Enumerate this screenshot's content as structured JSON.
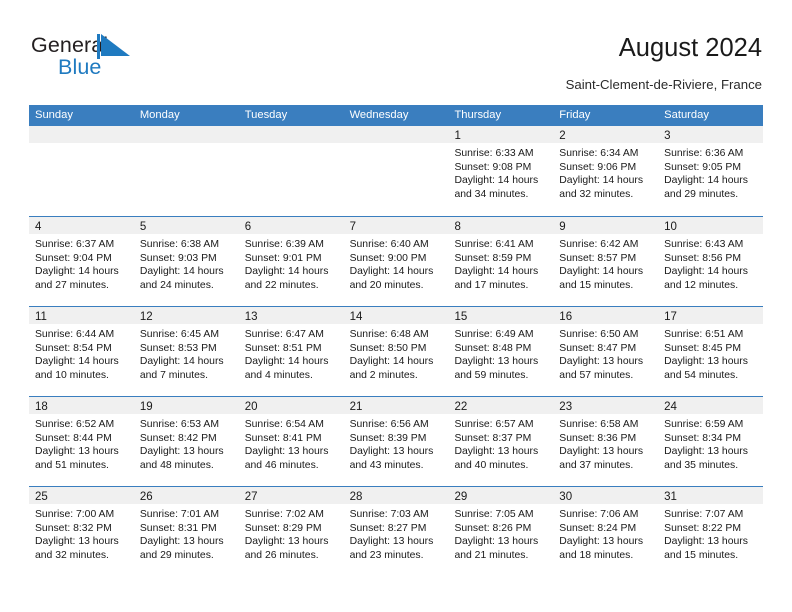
{
  "brand": {
    "name_top": "General",
    "name_bottom": "Blue",
    "mark": "triangle-logo-mark",
    "color_dark": "#231f20",
    "color_blue": "#1f7ac0"
  },
  "header": {
    "title": "August 2024",
    "subtitle": "Saint-Clement-de-Riviere, France"
  },
  "theme": {
    "header_blue": "#3a7ebf",
    "day_band_gray": "#f0f0f0",
    "text": "#1a1a1a"
  },
  "calendar": {
    "weekdays": [
      "Sunday",
      "Monday",
      "Tuesday",
      "Wednesday",
      "Thursday",
      "Friday",
      "Saturday"
    ],
    "weeks": [
      [
        {
          "day": "",
          "lines": []
        },
        {
          "day": "",
          "lines": []
        },
        {
          "day": "",
          "lines": []
        },
        {
          "day": "",
          "lines": []
        },
        {
          "day": "1",
          "lines": [
            "Sunrise: 6:33 AM",
            "Sunset: 9:08 PM",
            "Daylight: 14 hours",
            "and 34 minutes."
          ]
        },
        {
          "day": "2",
          "lines": [
            "Sunrise: 6:34 AM",
            "Sunset: 9:06 PM",
            "Daylight: 14 hours",
            "and 32 minutes."
          ]
        },
        {
          "day": "3",
          "lines": [
            "Sunrise: 6:36 AM",
            "Sunset: 9:05 PM",
            "Daylight: 14 hours",
            "and 29 minutes."
          ]
        }
      ],
      [
        {
          "day": "4",
          "lines": [
            "Sunrise: 6:37 AM",
            "Sunset: 9:04 PM",
            "Daylight: 14 hours",
            "and 27 minutes."
          ]
        },
        {
          "day": "5",
          "lines": [
            "Sunrise: 6:38 AM",
            "Sunset: 9:03 PM",
            "Daylight: 14 hours",
            "and 24 minutes."
          ]
        },
        {
          "day": "6",
          "lines": [
            "Sunrise: 6:39 AM",
            "Sunset: 9:01 PM",
            "Daylight: 14 hours",
            "and 22 minutes."
          ]
        },
        {
          "day": "7",
          "lines": [
            "Sunrise: 6:40 AM",
            "Sunset: 9:00 PM",
            "Daylight: 14 hours",
            "and 20 minutes."
          ]
        },
        {
          "day": "8",
          "lines": [
            "Sunrise: 6:41 AM",
            "Sunset: 8:59 PM",
            "Daylight: 14 hours",
            "and 17 minutes."
          ]
        },
        {
          "day": "9",
          "lines": [
            "Sunrise: 6:42 AM",
            "Sunset: 8:57 PM",
            "Daylight: 14 hours",
            "and 15 minutes."
          ]
        },
        {
          "day": "10",
          "lines": [
            "Sunrise: 6:43 AM",
            "Sunset: 8:56 PM",
            "Daylight: 14 hours",
            "and 12 minutes."
          ]
        }
      ],
      [
        {
          "day": "11",
          "lines": [
            "Sunrise: 6:44 AM",
            "Sunset: 8:54 PM",
            "Daylight: 14 hours",
            "and 10 minutes."
          ]
        },
        {
          "day": "12",
          "lines": [
            "Sunrise: 6:45 AM",
            "Sunset: 8:53 PM",
            "Daylight: 14 hours",
            "and 7 minutes."
          ]
        },
        {
          "day": "13",
          "lines": [
            "Sunrise: 6:47 AM",
            "Sunset: 8:51 PM",
            "Daylight: 14 hours",
            "and 4 minutes."
          ]
        },
        {
          "day": "14",
          "lines": [
            "Sunrise: 6:48 AM",
            "Sunset: 8:50 PM",
            "Daylight: 14 hours",
            "and 2 minutes."
          ]
        },
        {
          "day": "15",
          "lines": [
            "Sunrise: 6:49 AM",
            "Sunset: 8:48 PM",
            "Daylight: 13 hours",
            "and 59 minutes."
          ]
        },
        {
          "day": "16",
          "lines": [
            "Sunrise: 6:50 AM",
            "Sunset: 8:47 PM",
            "Daylight: 13 hours",
            "and 57 minutes."
          ]
        },
        {
          "day": "17",
          "lines": [
            "Sunrise: 6:51 AM",
            "Sunset: 8:45 PM",
            "Daylight: 13 hours",
            "and 54 minutes."
          ]
        }
      ],
      [
        {
          "day": "18",
          "lines": [
            "Sunrise: 6:52 AM",
            "Sunset: 8:44 PM",
            "Daylight: 13 hours",
            "and 51 minutes."
          ]
        },
        {
          "day": "19",
          "lines": [
            "Sunrise: 6:53 AM",
            "Sunset: 8:42 PM",
            "Daylight: 13 hours",
            "and 48 minutes."
          ]
        },
        {
          "day": "20",
          "lines": [
            "Sunrise: 6:54 AM",
            "Sunset: 8:41 PM",
            "Daylight: 13 hours",
            "and 46 minutes."
          ]
        },
        {
          "day": "21",
          "lines": [
            "Sunrise: 6:56 AM",
            "Sunset: 8:39 PM",
            "Daylight: 13 hours",
            "and 43 minutes."
          ]
        },
        {
          "day": "22",
          "lines": [
            "Sunrise: 6:57 AM",
            "Sunset: 8:37 PM",
            "Daylight: 13 hours",
            "and 40 minutes."
          ]
        },
        {
          "day": "23",
          "lines": [
            "Sunrise: 6:58 AM",
            "Sunset: 8:36 PM",
            "Daylight: 13 hours",
            "and 37 minutes."
          ]
        },
        {
          "day": "24",
          "lines": [
            "Sunrise: 6:59 AM",
            "Sunset: 8:34 PM",
            "Daylight: 13 hours",
            "and 35 minutes."
          ]
        }
      ],
      [
        {
          "day": "25",
          "lines": [
            "Sunrise: 7:00 AM",
            "Sunset: 8:32 PM",
            "Daylight: 13 hours",
            "and 32 minutes."
          ]
        },
        {
          "day": "26",
          "lines": [
            "Sunrise: 7:01 AM",
            "Sunset: 8:31 PM",
            "Daylight: 13 hours",
            "and 29 minutes."
          ]
        },
        {
          "day": "27",
          "lines": [
            "Sunrise: 7:02 AM",
            "Sunset: 8:29 PM",
            "Daylight: 13 hours",
            "and 26 minutes."
          ]
        },
        {
          "day": "28",
          "lines": [
            "Sunrise: 7:03 AM",
            "Sunset: 8:27 PM",
            "Daylight: 13 hours",
            "and 23 minutes."
          ]
        },
        {
          "day": "29",
          "lines": [
            "Sunrise: 7:05 AM",
            "Sunset: 8:26 PM",
            "Daylight: 13 hours",
            "and 21 minutes."
          ]
        },
        {
          "day": "30",
          "lines": [
            "Sunrise: 7:06 AM",
            "Sunset: 8:24 PM",
            "Daylight: 13 hours",
            "and 18 minutes."
          ]
        },
        {
          "day": "31",
          "lines": [
            "Sunrise: 7:07 AM",
            "Sunset: 8:22 PM",
            "Daylight: 13 hours",
            "and 15 minutes."
          ]
        }
      ]
    ]
  }
}
